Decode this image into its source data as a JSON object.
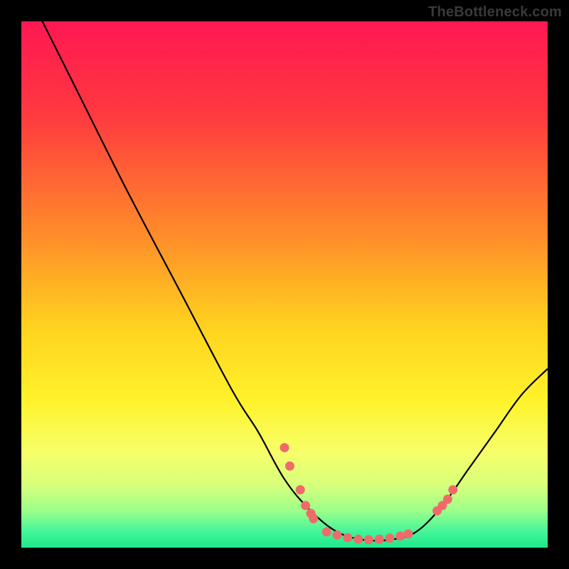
{
  "watermark": "TheBottleneck.com",
  "chart_data": {
    "type": "line",
    "title": "",
    "xlabel": "",
    "ylabel": "",
    "xlim": [
      0,
      100
    ],
    "ylim": [
      0,
      100
    ],
    "curve": [
      {
        "x": 4,
        "y": 100
      },
      {
        "x": 10,
        "y": 88
      },
      {
        "x": 20,
        "y": 68
      },
      {
        "x": 30,
        "y": 49
      },
      {
        "x": 40,
        "y": 30
      },
      {
        "x": 45,
        "y": 22
      },
      {
        "x": 50,
        "y": 13
      },
      {
        "x": 55,
        "y": 7
      },
      {
        "x": 60,
        "y": 3
      },
      {
        "x": 65,
        "y": 1.5
      },
      {
        "x": 70,
        "y": 1.5
      },
      {
        "x": 75,
        "y": 3
      },
      {
        "x": 80,
        "y": 8
      },
      {
        "x": 85,
        "y": 15
      },
      {
        "x": 90,
        "y": 22
      },
      {
        "x": 95,
        "y": 29
      },
      {
        "x": 100,
        "y": 34
      }
    ],
    "points": [
      {
        "x": 50,
        "y": 19
      },
      {
        "x": 51,
        "y": 15.5
      },
      {
        "x": 53,
        "y": 11
      },
      {
        "x": 54,
        "y": 8
      },
      {
        "x": 55,
        "y": 6.5
      },
      {
        "x": 55.5,
        "y": 5.5
      },
      {
        "x": 58,
        "y": 3
      },
      {
        "x": 60,
        "y": 2.4
      },
      {
        "x": 62,
        "y": 1.9
      },
      {
        "x": 64,
        "y": 1.6
      },
      {
        "x": 66,
        "y": 1.5
      },
      {
        "x": 68,
        "y": 1.6
      },
      {
        "x": 70,
        "y": 1.8
      },
      {
        "x": 72,
        "y": 2.2
      },
      {
        "x": 73.5,
        "y": 2.6
      },
      {
        "x": 79,
        "y": 7
      },
      {
        "x": 80,
        "y": 8
      },
      {
        "x": 81,
        "y": 9.2
      },
      {
        "x": 82,
        "y": 11
      }
    ],
    "gradient_stops": [
      {
        "pos": 0.0,
        "color": "#ff1752"
      },
      {
        "pos": 0.18,
        "color": "#ff3a3f"
      },
      {
        "pos": 0.4,
        "color": "#ff8a2a"
      },
      {
        "pos": 0.58,
        "color": "#ffd21f"
      },
      {
        "pos": 0.72,
        "color": "#fff22a"
      },
      {
        "pos": 0.82,
        "color": "#f6ff6a"
      },
      {
        "pos": 0.88,
        "color": "#d8ff7a"
      },
      {
        "pos": 0.93,
        "color": "#9cff8a"
      },
      {
        "pos": 0.97,
        "color": "#42f59a"
      },
      {
        "pos": 1.0,
        "color": "#1fe88b"
      }
    ],
    "point_color": "#ef6b6b",
    "curve_color": "#000000"
  }
}
